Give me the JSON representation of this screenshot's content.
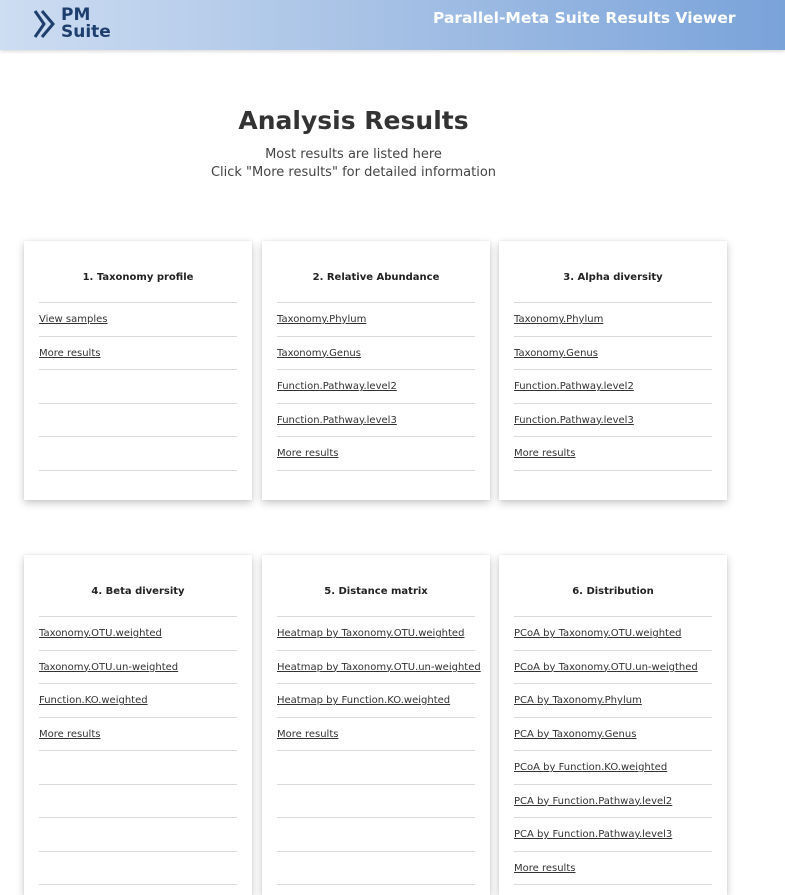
{
  "header": {
    "logo_text": "PM\nSuite",
    "title": "Parallel-Meta Suite Results Viewer"
  },
  "main": {
    "title": "Analysis Results",
    "subtitle_line1": "Most results are listed here",
    "subtitle_line2": "Click \"More results\" for detailed information"
  },
  "cards": [
    {
      "title": "1. Taxonomy profile",
      "links": [
        "View samples",
        "More results"
      ]
    },
    {
      "title": "2. Relative Abundance",
      "links": [
        "Taxonomy.Phylum",
        "Taxonomy.Genus",
        "Function.Pathway.level2",
        "Function.Pathway.level3",
        "More results"
      ]
    },
    {
      "title": "3. Alpha diversity",
      "links": [
        "Taxonomy.Phylum",
        "Taxonomy.Genus",
        "Function.Pathway.level2",
        "Function.Pathway.level3",
        "More results"
      ]
    },
    {
      "title": "4. Beta diversity",
      "links": [
        "Taxonomy.OTU.weighted",
        "Taxonomy.OTU.un-weighted",
        "Function.KO.weighted",
        "More results"
      ]
    },
    {
      "title": "5. Distance matrix",
      "links": [
        "Heatmap by Taxonomy.OTU.weighted",
        "Heatmap by Taxonomy.OTU.un-weighted",
        "Heatmap by Function.KO.weighted",
        "More results"
      ]
    },
    {
      "title": "6. Distribution",
      "links": [
        "PCoA by Taxonomy.OTU.weighted",
        "PCoA by Taxonomy.OTU.un-weigthed",
        "PCA by Taxonomy.Phylum",
        "PCA by Taxonomy.Genus",
        "PCoA by Function.KO.weighted",
        "PCA by Function.Pathway.level2",
        "PCA by Function.Pathway.level3",
        "More results"
      ]
    }
  ],
  "colors": {
    "header_gradient_start": "#cdddf2",
    "header_gradient_end": "#7aa3da",
    "logo": "#1e3f6e",
    "text": "#333333"
  }
}
